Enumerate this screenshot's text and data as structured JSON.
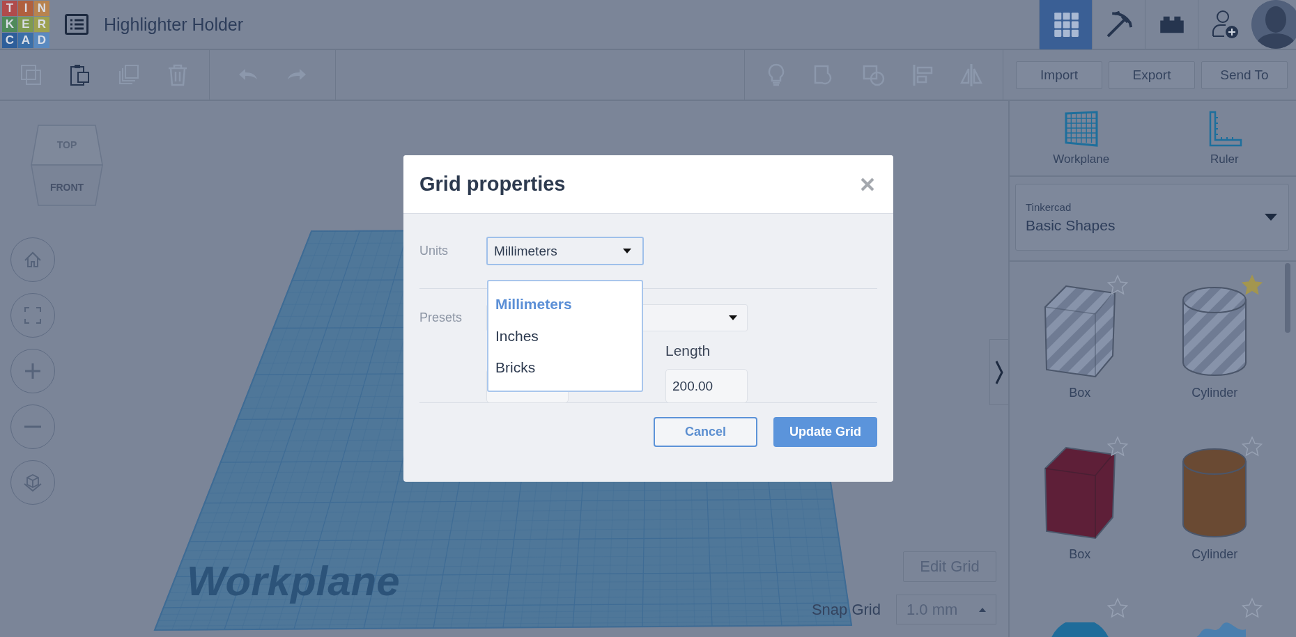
{
  "logo": [
    {
      "letter": "T",
      "color": "#b04b4c"
    },
    {
      "letter": "I",
      "color": "#b0603f"
    },
    {
      "letter": "N",
      "color": "#b8834f"
    },
    {
      "letter": "K",
      "color": "#4f8a5a"
    },
    {
      "letter": "E",
      "color": "#7f9a50"
    },
    {
      "letter": "R",
      "color": "#9ea150"
    },
    {
      "letter": "C",
      "color": "#2e5e9a"
    },
    {
      "letter": "A",
      "color": "#3b6fa8"
    },
    {
      "letter": "D",
      "color": "#5a8ac0"
    }
  ],
  "app": {
    "title": "Highlighter Holder"
  },
  "modes": [
    {
      "kind": "grid",
      "selected": true
    },
    {
      "kind": "pickaxe",
      "selected": false
    },
    {
      "kind": "bricks",
      "selected": false
    }
  ],
  "toolbar": {
    "edit_tools": [
      {
        "kind": "copy",
        "disabled": true
      },
      {
        "kind": "paste",
        "disabled": false
      },
      {
        "kind": "duplicate",
        "disabled": true
      },
      {
        "kind": "delete",
        "disabled": true
      }
    ],
    "history_tools": [
      {
        "kind": "undo",
        "disabled": true
      },
      {
        "kind": "redo",
        "disabled": true
      }
    ],
    "view_tools": [
      {
        "kind": "bulb",
        "disabled": true
      },
      {
        "kind": "group",
        "disabled": true
      },
      {
        "kind": "ungroup",
        "disabled": true
      },
      {
        "kind": "align",
        "disabled": true
      },
      {
        "kind": "mirror",
        "disabled": true
      }
    ],
    "actions": [
      "Import",
      "Export",
      "Send To"
    ]
  },
  "view_cube": {
    "top": "TOP",
    "front": "FRONT"
  },
  "navigation": [
    {
      "kind": "home"
    },
    {
      "kind": "fit"
    },
    {
      "kind": "zoom-in"
    },
    {
      "kind": "zoom-out"
    },
    {
      "kind": "perspective"
    }
  ],
  "workplane": {
    "label": "Workplane"
  },
  "edit_grid": "Edit Grid",
  "snap_grid": {
    "label": "Snap Grid",
    "value": "1.0 mm"
  },
  "panel": {
    "tools": [
      {
        "kind": "workplane",
        "label": "Workplane"
      },
      {
        "kind": "ruler",
        "label": "Ruler"
      }
    ],
    "library": {
      "source": "Tinkercad",
      "category": "Basic Shapes"
    },
    "shapes": [
      {
        "kind": "box",
        "hole": true,
        "color": "#8793aa",
        "label": "Box",
        "starred": false
      },
      {
        "kind": "cylinder",
        "hole": true,
        "color": "#8793aa",
        "label": "Cylinder",
        "starred": true
      },
      {
        "kind": "box",
        "hole": false,
        "color": "#5e1f38",
        "label": "Box",
        "starred": false
      },
      {
        "kind": "cylinder",
        "hole": false,
        "color": "#6a4a33",
        "label": "Cylinder",
        "starred": false
      },
      {
        "kind": "sphere",
        "color": "#1f6c9a",
        "starred": false
      },
      {
        "kind": "scribble",
        "color": "#4a7fae",
        "starred": false
      }
    ]
  },
  "dialog": {
    "title": "Grid properties",
    "units": {
      "label": "Units",
      "value": "Millimeters",
      "options": [
        {
          "label": "Millimeters",
          "selected": true
        },
        {
          "label": "Inches",
          "selected": false
        },
        {
          "label": "Bricks",
          "selected": false
        }
      ]
    },
    "presets": {
      "label": "Presets"
    },
    "length": {
      "label": "Length",
      "value": "200.00"
    },
    "buttons": [
      {
        "kind": "secondary",
        "label": "Cancel"
      },
      {
        "kind": "primary",
        "label": "Update Grid"
      }
    ]
  }
}
